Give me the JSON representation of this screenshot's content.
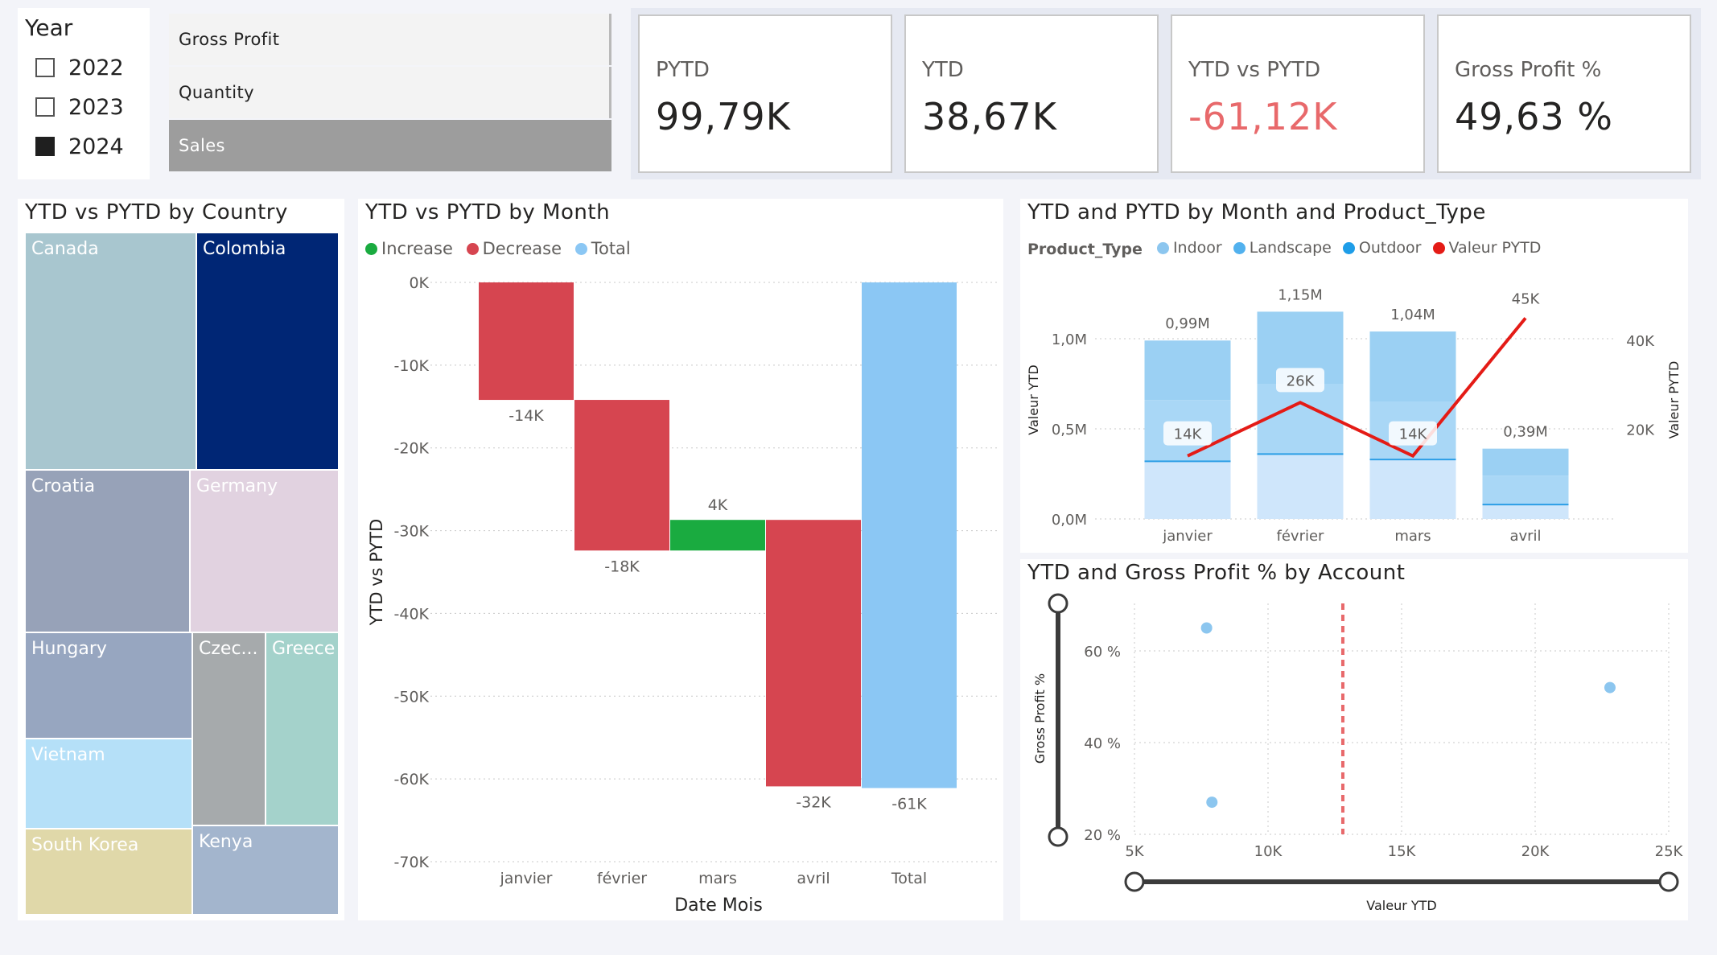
{
  "year_slicer": {
    "title": "Year",
    "options": [
      {
        "label": "2022",
        "checked": false
      },
      {
        "label": "2023",
        "checked": false
      },
      {
        "label": "2024",
        "checked": true
      }
    ]
  },
  "measure_buttons": [
    {
      "label": "Gross Profit",
      "selected": false
    },
    {
      "label": "Quantity",
      "selected": false
    },
    {
      "label": "Sales",
      "selected": true
    }
  ],
  "kpis": [
    {
      "label": "PYTD",
      "value": "99,79K",
      "color": "#252423"
    },
    {
      "label": "YTD",
      "value": "38,67K",
      "color": "#252423"
    },
    {
      "label": "YTD vs PYTD",
      "value": "-61,12K",
      "color": "#e8696b"
    },
    {
      "label": "Gross Profit %",
      "value": "49,63 %",
      "color": "#252423"
    }
  ],
  "treemap": {
    "title": "YTD vs PYTD by Country",
    "tiles": [
      {
        "label": "Canada",
        "color": "#a8c6cf"
      },
      {
        "label": "Colombia",
        "color": "#002675"
      },
      {
        "label": "Croatia",
        "color": "#97a2b8"
      },
      {
        "label": "Germany",
        "color": "#e1d2e0"
      },
      {
        "label": "Hungary",
        "color": "#97a6c0"
      },
      {
        "label": "Czec...",
        "color": "#a6aaac"
      },
      {
        "label": "Greece",
        "color": "#a4d2cb"
      },
      {
        "label": "Vietnam",
        "color": "#b5e0f8"
      },
      {
        "label": "South Korea",
        "color": "#e0d8a9"
      },
      {
        "label": "Kenya",
        "color": "#a3b5cd"
      }
    ]
  },
  "waterfall": {
    "title": "YTD vs PYTD by Month",
    "legend": [
      {
        "label": "Increase",
        "color": "#1aab40"
      },
      {
        "label": "Decrease",
        "color": "#d64550"
      },
      {
        "label": "Total",
        "color": "#8bc7f4"
      }
    ],
    "y_ticks": [
      "0K",
      "-10K",
      "-20K",
      "-30K",
      "-40K",
      "-50K",
      "-60K",
      "-70K"
    ],
    "y_label": "YTD vs PYTD",
    "x_label": "Date Mois",
    "bar_labels": [
      "-14K",
      "-18K",
      "4K",
      "-32K",
      "-61K"
    ]
  },
  "combo": {
    "title": "YTD and PYTD by Month and Product_Type",
    "legend_title": "Product_Type",
    "legend": [
      {
        "label": "Indoor",
        "color": "#8cc6ef"
      },
      {
        "label": "Landscape",
        "color": "#52b1ee"
      },
      {
        "label": "Outdoor",
        "color": "#1e9de8"
      },
      {
        "label": "Valeur PYTD",
        "color": "#e41b16"
      }
    ],
    "y_left_label": "Valeur YTD",
    "y_right_label": "Valeur PYTD",
    "y_left_ticks": [
      "1,0M",
      "0,5M",
      "0,0M"
    ],
    "y_right_ticks": [
      "40K",
      "20K"
    ],
    "bar_totals": [
      "0,99M",
      "1,15M",
      "1,04M",
      "0,39M"
    ],
    "line_labels": [
      "14K",
      "26K",
      "14K",
      "45K"
    ]
  },
  "scatter": {
    "title": "YTD and Gross Profit % by Account",
    "x_label": "Valeur YTD",
    "y_label": "Gross Profit %",
    "x_ticks": [
      "5K",
      "10K",
      "15K",
      "20K",
      "25K"
    ],
    "y_ticks": [
      "60 %",
      "40 %",
      "20 %"
    ]
  },
  "chart_data": [
    {
      "type": "bar",
      "subtype": "waterfall",
      "title": "YTD vs PYTD by Month",
      "xlabel": "Date Mois",
      "ylabel": "YTD vs PYTD",
      "categories": [
        "janvier",
        "février",
        "mars",
        "avril",
        "Total"
      ],
      "values": [
        -14.2,
        -18.2,
        3.7,
        -32.2,
        -61.1
      ],
      "value_unit": "K",
      "ylim": [
        -70,
        0
      ]
    },
    {
      "type": "bar",
      "subtype": "stacked-bar-with-line",
      "title": "YTD and PYTD by Month and Product_Type",
      "categories": [
        "janvier",
        "février",
        "mars",
        "avril"
      ],
      "series": [
        {
          "name": "Indoor",
          "axis": "left",
          "values": [
            0.32,
            0.36,
            0.33,
            0.08
          ]
        },
        {
          "name": "Landscape",
          "axis": "left",
          "values": [
            0.34,
            0.39,
            0.32,
            0.16
          ]
        },
        {
          "name": "Outdoor",
          "axis": "left",
          "values": [
            0.33,
            0.4,
            0.39,
            0.15
          ]
        },
        {
          "name": "Valeur PYTD",
          "axis": "right",
          "type": "line",
          "values": [
            14,
            26,
            14,
            45
          ]
        }
      ],
      "totals": [
        0.99,
        1.15,
        1.04,
        0.39
      ],
      "ylabel_left": "Valeur YTD",
      "ylabel_right": "Valeur PYTD",
      "ylim_left": [
        0,
        1.0
      ],
      "ylim_right": [
        0,
        40
      ]
    },
    {
      "type": "scatter",
      "title": "YTD and Gross Profit % by Account",
      "xlabel": "Valeur YTD",
      "ylabel": "Gross Profit %",
      "xlim": [
        5,
        25
      ],
      "ylim": [
        20,
        60
      ],
      "points": [
        {
          "x": 7.7,
          "y": 65
        },
        {
          "x": 7.9,
          "y": 27
        },
        {
          "x": 22.8,
          "y": 52
        }
      ],
      "reference_line_x": 12.8
    }
  ]
}
